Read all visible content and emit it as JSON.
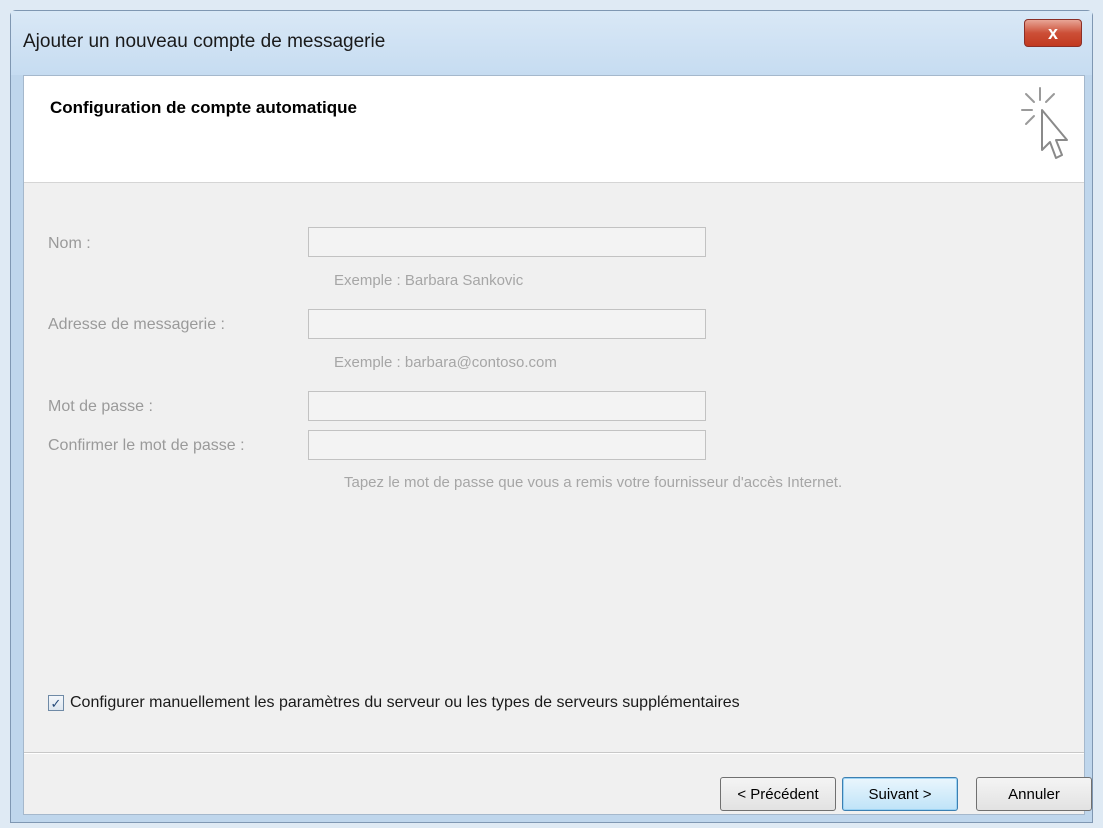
{
  "window": {
    "title": "Ajouter un nouveau compte de messagerie",
    "close_label": "x"
  },
  "header": {
    "title": "Configuration de compte automatique"
  },
  "form": {
    "name_label": "Nom :",
    "name_value": "",
    "name_hint": "Exemple : Barbara Sankovic",
    "email_label": "Adresse de messagerie :",
    "email_value": "",
    "email_hint": "Exemple : barbara@contoso.com",
    "password_label": "Mot de passe :",
    "password_value": "",
    "confirm_label": "Confirmer le mot de passe :",
    "confirm_value": "",
    "password_hint": "Tapez le mot de passe que vous a remis votre fournisseur d'accès Internet."
  },
  "manual_config": {
    "checked": true,
    "label": "Configurer manuellement les paramètres du serveur ou les types de serveurs supplémentaires"
  },
  "buttons": {
    "back": "< Précédent",
    "next": "Suivant >",
    "cancel": "Annuler"
  },
  "colors": {
    "disabled_text": "#9a9a9a",
    "default_button": "#bfe3f8"
  }
}
